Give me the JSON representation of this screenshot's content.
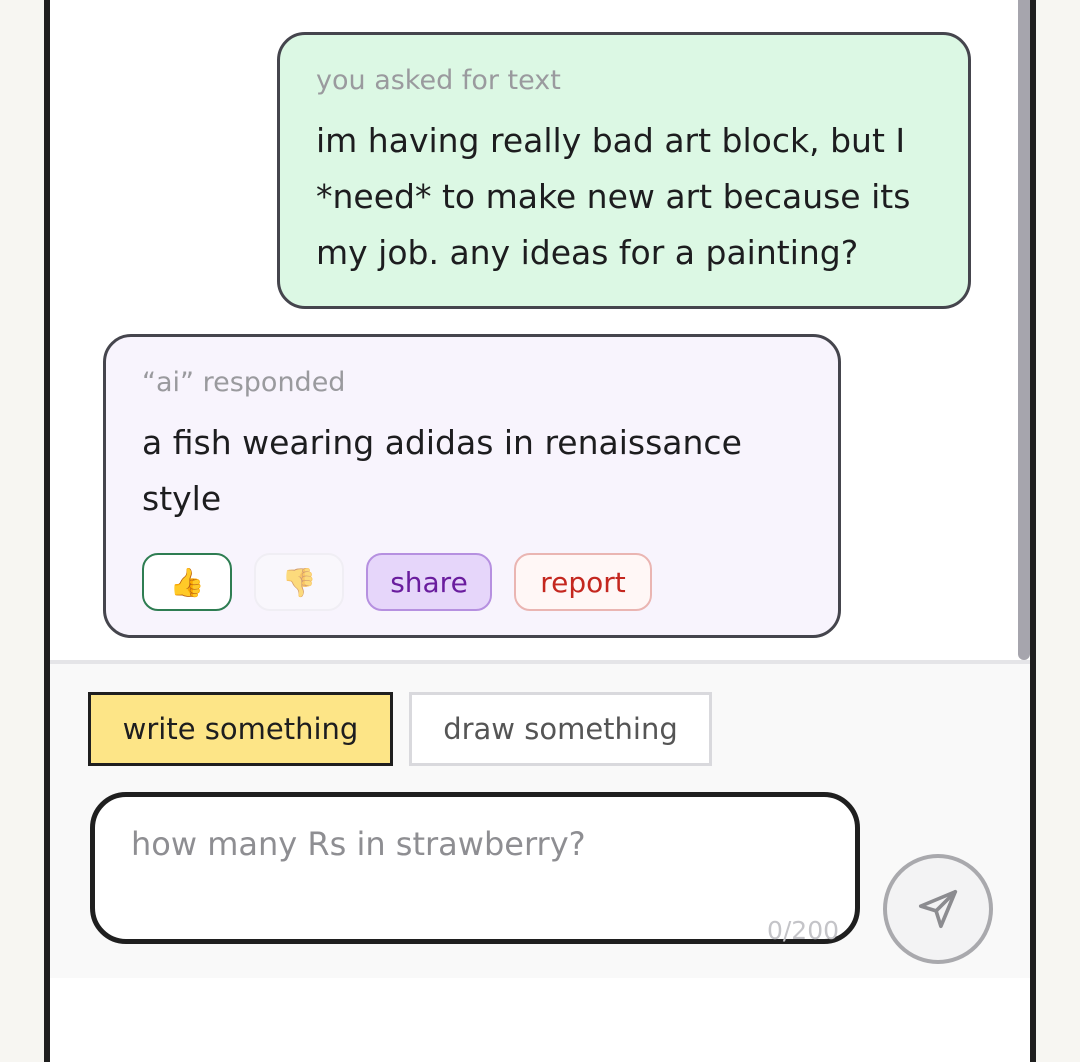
{
  "conversation": {
    "user_message": {
      "meta": "you asked for text",
      "text": "im having really bad art block, but I *need* to make new art because its my job. any ideas for a painting?"
    },
    "ai_message": {
      "meta": "“ai” responded",
      "text": "a fish wearing adidas in renaissance style",
      "reactions": {
        "thumb_up_icon": "👍",
        "thumb_down_icon": "👎",
        "share_label": "share",
        "report_label": "report"
      }
    }
  },
  "composer": {
    "tabs": {
      "write_label": "write something",
      "draw_label": "draw something",
      "active": "write"
    },
    "input": {
      "placeholder": "how many Rs in strawberry?",
      "value": ""
    },
    "char_count": "0/200",
    "send_icon": "send-paper-plane-icon"
  },
  "colors": {
    "user_bubble": "#dcf8e4",
    "ai_bubble": "#f8f4fd",
    "active_tab": "#fde587",
    "share": "#6a1d9e",
    "report": "#c4271f"
  }
}
